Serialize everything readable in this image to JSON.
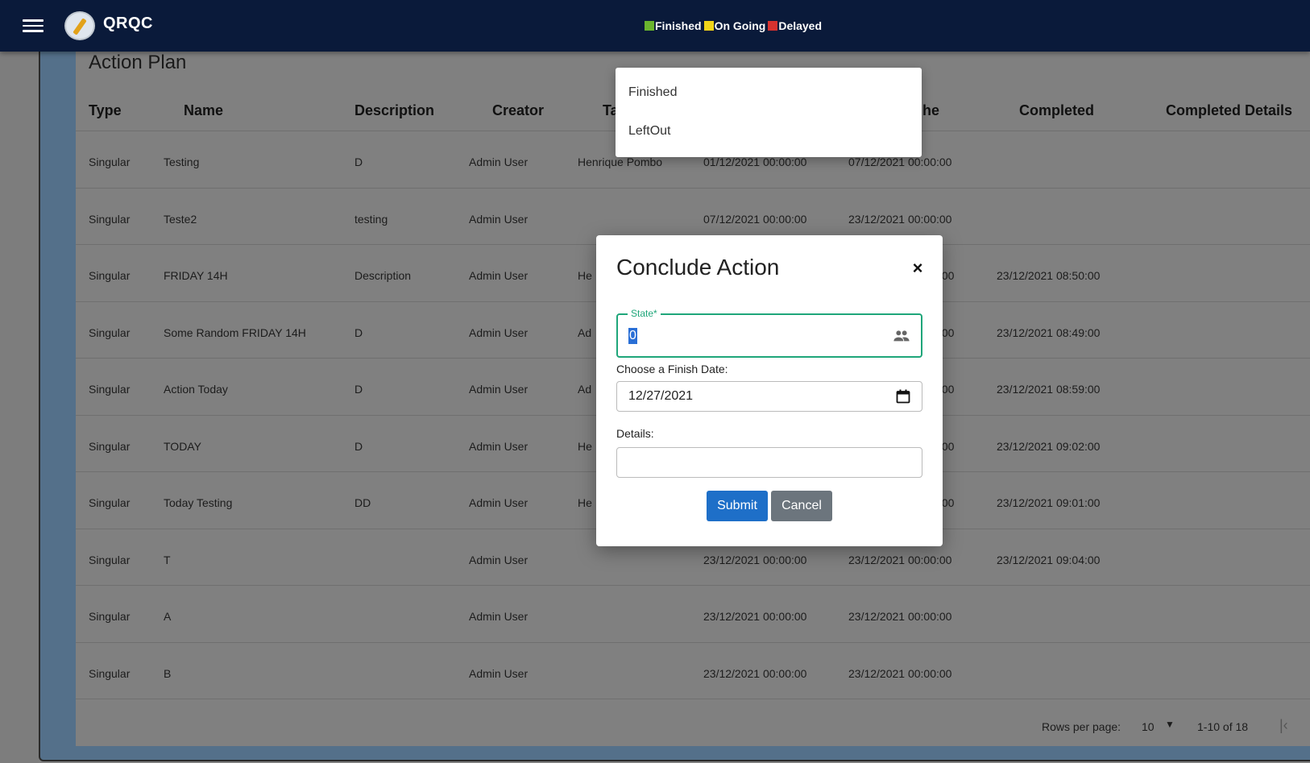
{
  "appbar": {
    "title": "QRQC",
    "legend": [
      {
        "label": "Finished",
        "color": "#6ab42e"
      },
      {
        "label": "On Going",
        "color": "#f0d419"
      },
      {
        "label": "Delayed",
        "color": "#d8322f"
      }
    ]
  },
  "page": {
    "title": "Action Plan",
    "columns": [
      "Type",
      "Name",
      "Description",
      "Creator",
      "Ta",
      "he",
      "Completed",
      "Completed Details"
    ],
    "rows": [
      [
        "Singular",
        "Testing",
        "D",
        "Admin User",
        "Henrique Pombo",
        "01/12/2021 00:00:00",
        "07/12/2021 00:00:00",
        ""
      ],
      [
        "Singular",
        "Teste2",
        "testing",
        "Admin User",
        "",
        "07/12/2021 00:00:00",
        "23/12/2021 00:00:00",
        ""
      ],
      [
        "Singular",
        "FRIDAY 14H",
        "Description",
        "Admin User",
        "He",
        ":00",
        "",
        "23/12/2021 08:50:00"
      ],
      [
        "Singular",
        "Some Random FRIDAY 14H",
        "D",
        "Admin User",
        "Ad",
        ":00",
        "",
        "23/12/2021 08:49:00"
      ],
      [
        "Singular",
        "Action Today",
        "D",
        "Admin User",
        "Ad",
        ":00",
        "",
        "23/12/2021 08:59:00"
      ],
      [
        "Singular",
        "TODAY",
        "D",
        "Admin User",
        "He",
        ":00",
        "",
        "23/12/2021 09:02:00"
      ],
      [
        "Singular",
        "Today Testing",
        "DD",
        "Admin User",
        "He",
        ":00",
        "",
        "23/12/2021 09:01:00"
      ],
      [
        "Singular",
        "T",
        "",
        "Admin User",
        "",
        "23/12/2021 00:00:00",
        "23/12/2021 00:00:00",
        "23/12/2021 09:04:00"
      ],
      [
        "Singular",
        "A",
        "",
        "Admin User",
        "",
        "23/12/2021 00:00:00",
        "23/12/2021 00:00:00",
        ""
      ],
      [
        "Singular",
        "B",
        "",
        "Admin User",
        "",
        "23/12/2021 00:00:00",
        "23/12/2021 00:00:00",
        ""
      ]
    ],
    "footer": {
      "rows_per_page_label": "Rows per page:",
      "rows_per_page_value": "10",
      "range": "1-10 of 18"
    }
  },
  "dialog": {
    "title": "Conclude Action",
    "close_label": "×",
    "state_label": "State*",
    "state_value": "0",
    "date_label": "Choose a Finish Date:",
    "date_value": "12/27/2021",
    "details_label": "Details:",
    "details_value": "",
    "submit_label": "Submit",
    "cancel_label": "Cancel"
  },
  "dropdown": {
    "options": [
      "Finished",
      "LeftOut"
    ]
  }
}
